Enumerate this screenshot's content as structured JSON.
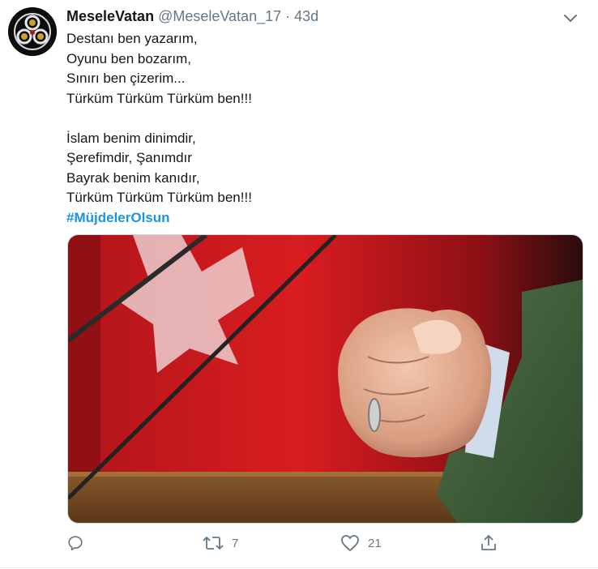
{
  "tweet": {
    "display_name": "MeseleVatan",
    "handle": "@MeseleVatan_17",
    "separator": "·",
    "time": "43d",
    "lines": [
      "Destanı ben yazarım,",
      "Oyunu ben bozarım,",
      "Sınırı ben çizerim...",
      "Türküm Türküm Türküm ben!!!",
      "",
      "İslam benim dinimdir,",
      "Şerefimdir, Şanımdır",
      "Bayrak benim kanıdır,",
      "Türküm Türküm Türküm ben!!!"
    ],
    "hashtag": "#MüjdelerOlsun"
  },
  "actions": {
    "reply_icon": "reply-icon",
    "retweet_icon": "retweet-icon",
    "retweet_count": "7",
    "like_icon": "heart-icon",
    "like_count": "21",
    "share_icon": "share-icon"
  },
  "colors": {
    "text": "#14171a",
    "muted": "#657786",
    "link": "#1b95e0",
    "flag_red": "#d71a1c",
    "jacket_green": "#3f5f3b"
  }
}
